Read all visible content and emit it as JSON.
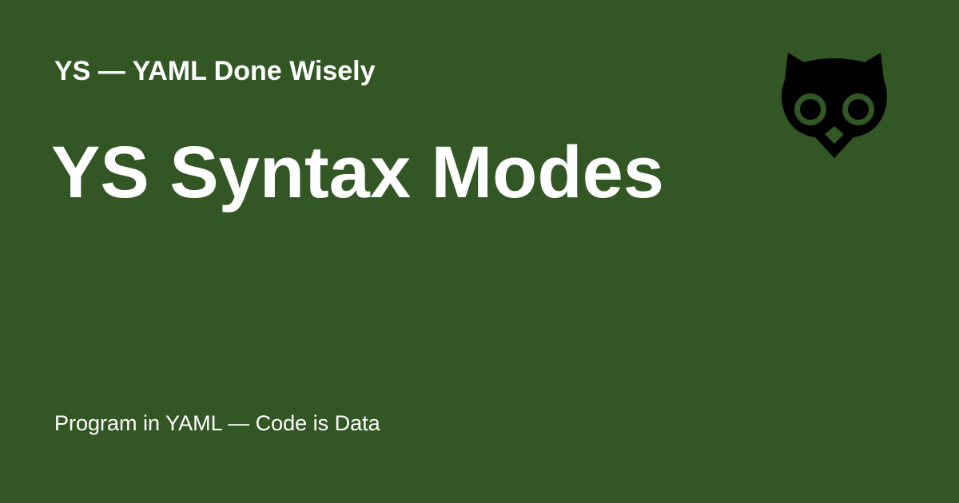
{
  "social_card": {
    "site_name": "YS — YAML Done Wisely",
    "title": "YS Syntax Modes",
    "tagline": "Program in YAML — Code is Data"
  },
  "logo": {
    "icon": "owl-icon"
  },
  "colors": {
    "background": "#335724",
    "text": "#ffffff",
    "logo": "#000000"
  }
}
